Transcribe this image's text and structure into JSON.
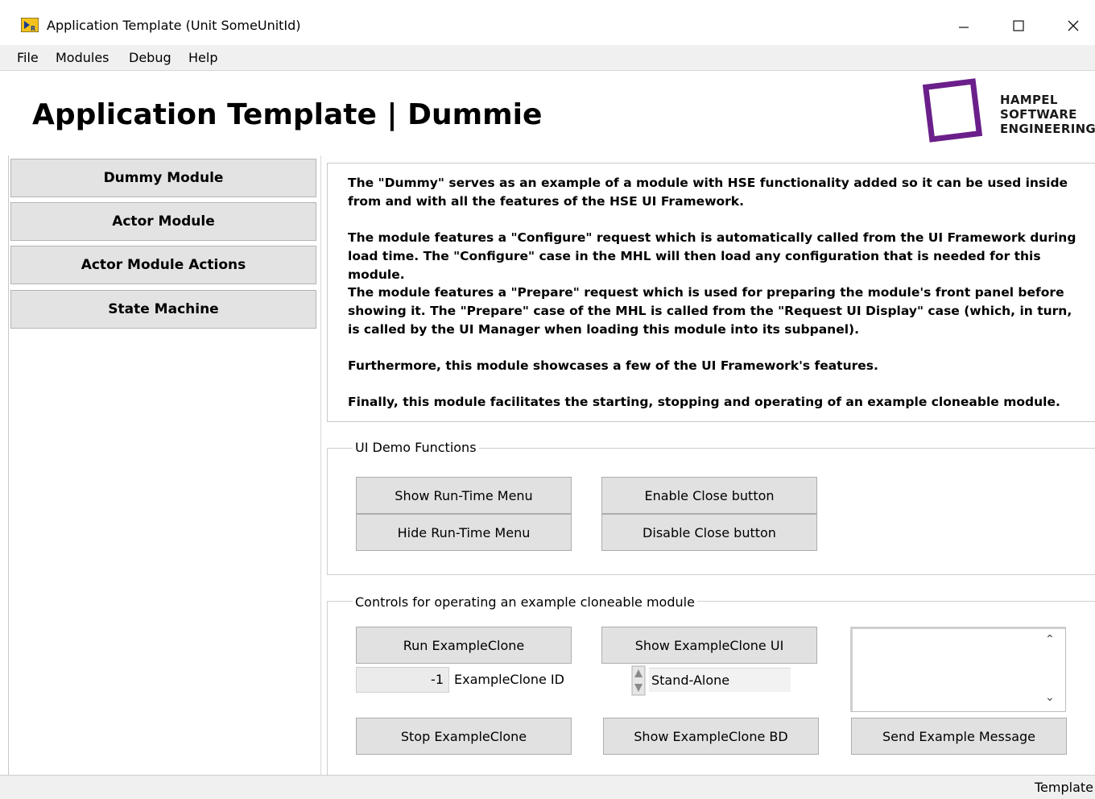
{
  "window": {
    "title": "Application Template (Unit SomeUnitId)",
    "icon": "labview-app-icon",
    "controls": [
      "minimize-icon",
      "maximize-icon",
      "close-icon"
    ]
  },
  "menu": {
    "items": [
      {
        "label": "File"
      },
      {
        "label": "Modules"
      },
      {
        "label": "Debug"
      },
      {
        "label": "Help"
      }
    ]
  },
  "header": {
    "title": "Application Template | Dummie",
    "logo": {
      "line1": "HAMPEL",
      "line2": "SOFTWARE",
      "line3": "ENGINEERING",
      "color": "#6b1f8a"
    }
  },
  "nav": {
    "items": [
      {
        "label": "Dummy Module"
      },
      {
        "label": "Actor Module"
      },
      {
        "label": "Actor Module Actions"
      },
      {
        "label": "State Machine"
      }
    ]
  },
  "description": {
    "paragraphs": [
      "The \"Dummy\" serves as an example of a module with HSE functionality added so it can be used inside from and with all the features of the HSE UI Framework.",
      "The module features a \"Configure\" request which is automatically called from the UI Framework during load time. The \"Configure\" case in the MHL will then load any configuration that is needed for this module.",
      "The module features a \"Prepare\" request which is used for preparing the module's front panel before showing it. The \"Prepare\" case of the MHL is called from the \"Request UI Display\" case (which, in turn, is called by the UI Manager when loading this module into its subpanel).",
      "Furthermore, this module showcases a few of the UI Framework's features.",
      "Finally, this module facilitates the starting, stopping and  operating of an example cloneable module."
    ]
  },
  "ui_demo": {
    "label": "UI Demo Functions",
    "show_menu": "Show Run-Time Menu",
    "hide_menu": "Hide Run-Time Menu",
    "enable_close": "Enable Close button",
    "disable_close": "Disable Close button"
  },
  "clone": {
    "label": "Controls for operating an example cloneable module",
    "run": "Run ExampleClone",
    "show_ui": "Show ExampleClone UI",
    "id_value": "-1",
    "id_label": "ExampleClone ID",
    "mode_value": "Stand-Alone",
    "stop": "Stop ExampleClone",
    "show_bd": "Show ExampleClone BD",
    "send_msg": "Send Example Message",
    "message_text": ""
  },
  "status": {
    "text": "Template"
  }
}
